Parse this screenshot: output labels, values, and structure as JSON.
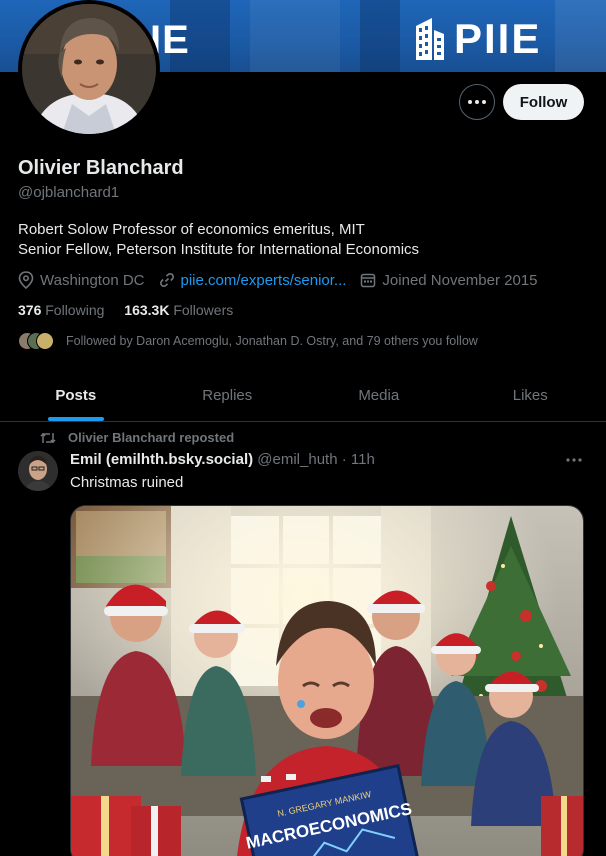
{
  "banner": {
    "left_text": "IE",
    "logo_text": "PIIE"
  },
  "profile": {
    "name": "Olivier Blanchard",
    "handle": "@ojblanchard1",
    "bio_line1": "Robert Solow Professor of economics emeritus, MIT",
    "bio_line2": "Senior Fellow, Peterson Institute for International Economics",
    "location": "Washington DC",
    "link": "piie.com/experts/senior...",
    "joined": "Joined November 2015",
    "following_count": "376",
    "following_label": "Following",
    "followers_count": "163.3K",
    "followers_label": "Followers",
    "followed_by": "Followed by Daron Acemoglu, Jonathan D. Ostry, and 79 others you follow"
  },
  "actions": {
    "follow_label": "Follow",
    "more_icon": "more-horizontal-icon"
  },
  "tabs": [
    {
      "label": "Posts",
      "active": true
    },
    {
      "label": "Replies",
      "active": false
    },
    {
      "label": "Media",
      "active": false
    },
    {
      "label": "Likes",
      "active": false
    }
  ],
  "tweet": {
    "repost_text": "Olivier Blanchard reposted",
    "author_name": "Emil (emilhth.bsky.social)",
    "author_handle": "@emil_huth",
    "separator": "·",
    "time": "11h",
    "text": "Christmas ruined",
    "media_book_author": "N. GREGARY MANKIW",
    "media_book_title": "MACROECONOMICS"
  },
  "colors": {
    "accent": "#1d9bf0",
    "muted": "#71767b",
    "text": "#e7e9ea",
    "background": "#000000"
  }
}
